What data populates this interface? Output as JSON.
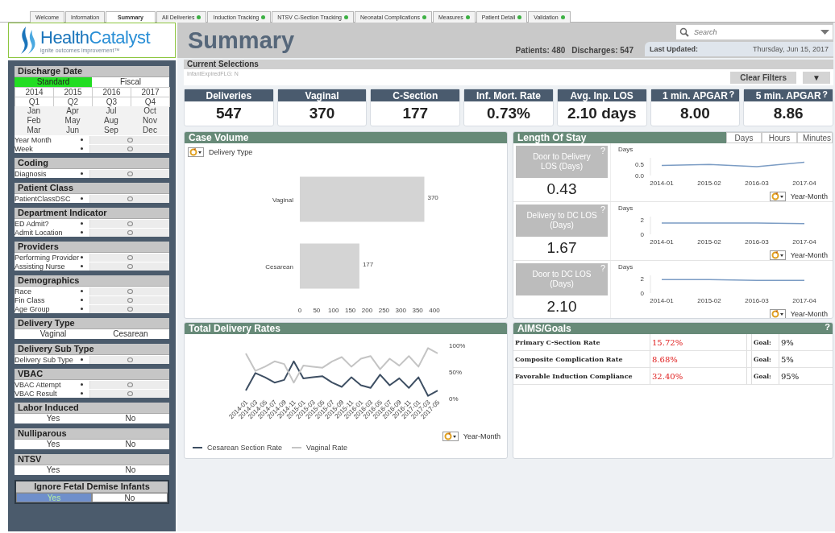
{
  "tabs": [
    {
      "label": "Welcome",
      "selected": false,
      "indicator": false
    },
    {
      "label": "Information",
      "selected": false,
      "indicator": false
    },
    {
      "label": "Summary",
      "selected": true,
      "indicator": false
    },
    {
      "label": "All Deliveries",
      "selected": false,
      "indicator": true
    },
    {
      "label": "Induction Tracking",
      "selected": false,
      "indicator": true
    },
    {
      "label": "NTSV C-Section Tracking",
      "selected": false,
      "indicator": true
    },
    {
      "label": "Neonatal Complications",
      "selected": false,
      "indicator": true
    },
    {
      "label": "Measures",
      "selected": false,
      "indicator": true
    },
    {
      "label": "Patient Detail",
      "selected": false,
      "indicator": true
    },
    {
      "label": "Validation",
      "selected": false,
      "indicator": true
    }
  ],
  "logo": {
    "wordmark_first": "Health",
    "wordmark_second": "Catalyst",
    "tagline": "ignite outcomes improvement™"
  },
  "header": {
    "title": "Summary",
    "patients": "Patients: 480",
    "discharges": "Discharges: 547",
    "search": {
      "placeholder": "Search"
    },
    "last_updated_label": "Last Updated:",
    "last_updated_value": "Thursday, Jun 15, 2017"
  },
  "sidebar": {
    "sections": [
      {
        "title": "Discharge Date",
        "kind": "panel",
        "blocks": [
          {
            "kind": "toggle",
            "options": [
              {
                "label": "Standard",
                "selected": true
              },
              {
                "label": "Fiscal",
                "selected": false
              }
            ]
          },
          {
            "kind": "grid",
            "framed": true,
            "rows": [
              [
                "2014",
                "2015",
                "2016",
                "2017"
              ]
            ]
          },
          {
            "kind": "grid",
            "framed": true,
            "rows": [
              [
                "Q1",
                "Q2",
                "Q3",
                "Q4"
              ]
            ]
          },
          {
            "kind": "grid",
            "framed": false,
            "rows": [
              [
                "Jan",
                "Apr",
                "Jul",
                "Oct"
              ],
              [
                "Feb",
                "May",
                "Aug",
                "Nov"
              ],
              [
                "Mar",
                "Jun",
                "Sep",
                "Dec"
              ]
            ]
          },
          {
            "kind": "dropdowns",
            "items": [
              "Year Month",
              "Week"
            ]
          }
        ]
      },
      {
        "title": "Coding",
        "kind": "panel",
        "blocks": [
          {
            "kind": "dropdowns",
            "items": [
              "Diagnosis"
            ]
          }
        ]
      },
      {
        "title": "Patient Class",
        "kind": "panel",
        "blocks": [
          {
            "kind": "dropdowns",
            "items": [
              "PatientClassDSC"
            ]
          }
        ]
      },
      {
        "title": "Department Indicator",
        "kind": "panel",
        "blocks": [
          {
            "kind": "dropdowns",
            "items": [
              "ED Admit?",
              "Admit Location"
            ]
          }
        ]
      },
      {
        "title": "Providers",
        "kind": "panel",
        "blocks": [
          {
            "kind": "dropdowns",
            "items": [
              "Performing Provider",
              "Assisting Nurse"
            ]
          }
        ]
      },
      {
        "title": "Demographics",
        "kind": "panel",
        "blocks": [
          {
            "kind": "dropdowns",
            "items": [
              "Race",
              "Fin Class",
              "Age Group"
            ]
          }
        ]
      },
      {
        "title": "Delivery Type",
        "kind": "panel",
        "blocks": [
          {
            "kind": "toggle",
            "options": [
              {
                "label": "Vaginal",
                "selected": false
              },
              {
                "label": "Cesarean",
                "selected": false
              }
            ]
          }
        ]
      },
      {
        "title": "Delivery Sub Type",
        "kind": "panel",
        "blocks": [
          {
            "kind": "dropdowns",
            "items": [
              "Delivery Sub Type"
            ]
          }
        ]
      },
      {
        "title": "VBAC",
        "kind": "panel",
        "blocks": [
          {
            "kind": "dropdowns",
            "items": [
              "VBAC Attempt",
              "VBAC Result"
            ]
          }
        ]
      },
      {
        "title": "Labor Induced",
        "kind": "panel",
        "blocks": [
          {
            "kind": "toggle",
            "options": [
              {
                "label": "Yes",
                "selected": false
              },
              {
                "label": "No",
                "selected": false
              }
            ]
          }
        ]
      },
      {
        "title": "Nulliparous",
        "kind": "panel",
        "blocks": [
          {
            "kind": "toggle",
            "options": [
              {
                "label": "Yes",
                "selected": false
              },
              {
                "label": "No",
                "selected": false
              }
            ]
          }
        ]
      },
      {
        "title": "NTSV",
        "kind": "panel",
        "blocks": [
          {
            "kind": "toggle",
            "options": [
              {
                "label": "Yes",
                "selected": false
              },
              {
                "label": "No",
                "selected": false
              }
            ]
          }
        ]
      },
      {
        "title": "Ignore Fetal Demise Infants",
        "kind": "boxed",
        "blocks": [
          {
            "kind": "toggle",
            "options": [
              {
                "label": "Yes",
                "selected": true
              },
              {
                "label": "No",
                "selected": false
              }
            ]
          }
        ]
      }
    ]
  },
  "current_selections": {
    "title": "Current Selections",
    "items": [
      "InfantExpiredFLG: N"
    ],
    "clear_button": "Clear Filters",
    "menu_button": "▼"
  },
  "kpis": [
    {
      "label": "Deliveries",
      "value": "547"
    },
    {
      "label": "Vaginal",
      "value": "370"
    },
    {
      "label": "C-Section",
      "value": "177"
    },
    {
      "label": "Inf. Mort. Rate",
      "value": "0.73%"
    },
    {
      "label": "Avg. Inp. LOS",
      "value": "2.10 days"
    },
    {
      "label": "1 min. APGAR",
      "help": "?",
      "value": "8.00"
    },
    {
      "label": "5 min. APGAR",
      "help": "?",
      "value": "8.86"
    }
  ],
  "case_volume": {
    "title": "Case Volume",
    "chart_data": {
      "type": "bar",
      "orientation": "horizontal",
      "ylabel": "Delivery Type",
      "categories": [
        "Vaginal",
        "Cesarean"
      ],
      "values": [
        370,
        177
      ],
      "xlim": [
        0,
        400
      ],
      "xticks": [
        0,
        50,
        100,
        150,
        200,
        250,
        300,
        350,
        400
      ],
      "data_labels": true
    }
  },
  "length_of_stay": {
    "title": "Length Of Stay",
    "units": [
      "Days",
      "Hours",
      "Minutes"
    ],
    "metrics": [
      {
        "label": "Door to Delivery LOS (Days)",
        "help": "?",
        "value": "0.43",
        "chart_data": {
          "type": "line",
          "ylabel": "Days",
          "xlabel": "Year-Month",
          "categories": [
            "2014-01",
            "2015-02",
            "2016-03",
            "2017-04"
          ],
          "ylim": [
            0,
            0.8
          ],
          "yticks": [
            {
              "value": 0,
              "label": "0.0"
            },
            {
              "value": 0.5,
              "label": "0.5"
            }
          ],
          "series": [
            {
              "color": "#7b9cc4",
              "values": [
                0.45,
                0.5,
                0.4,
                0.6
              ]
            }
          ]
        }
      },
      {
        "label": "Delivery to DC LOS (Days)",
        "help": "?",
        "value": "1.67",
        "chart_data": {
          "type": "line",
          "ylabel": "Days",
          "xlabel": "Year-Month",
          "categories": [
            "2014-01",
            "2015-02",
            "2016-03",
            "2017-04"
          ],
          "ylim": [
            0,
            2.5
          ],
          "yticks": [
            {
              "value": 0,
              "label": "0"
            },
            {
              "value": 2,
              "label": "2"
            }
          ],
          "series": [
            {
              "color": "#7b9cc4",
              "values": [
                1.6,
                1.6,
                1.6,
                1.5
              ]
            }
          ]
        }
      },
      {
        "label": "Door to DC LOS (Days)",
        "help": "?",
        "value": "2.10",
        "chart_data": {
          "type": "line",
          "ylabel": "Days",
          "xlabel": "Year-Month",
          "categories": [
            "2014-01",
            "2015-02",
            "2016-03",
            "2017-04"
          ],
          "ylim": [
            0,
            2.5
          ],
          "yticks": [
            {
              "value": 0,
              "label": "0"
            },
            {
              "value": 2,
              "label": "2"
            }
          ],
          "series": [
            {
              "color": "#7b9cc4",
              "values": [
                1.9,
                1.9,
                1.8,
                1.8
              ]
            }
          ]
        }
      }
    ]
  },
  "delivery_rates": {
    "title": "Total Delivery Rates",
    "chart_data": {
      "type": "line",
      "xlabel": "Year-Month",
      "ylim": [
        0,
        1
      ],
      "yticks": [
        {
          "value": 0,
          "label": "0%"
        },
        {
          "value": 0.5,
          "label": "50%"
        },
        {
          "value": 1,
          "label": "100%"
        }
      ],
      "categories": [
        "2014-01",
        "2014-03",
        "2014-05",
        "2014-07",
        "2014-09",
        "2014-11",
        "2015-01",
        "2015-03",
        "2015-05",
        "2015-07",
        "2015-09",
        "2015-11",
        "2016-01",
        "2016-03",
        "2016-05",
        "2016-07",
        "2016-09",
        "2016-11",
        "2017-01",
        "2017-03",
        "2017-05"
      ],
      "series": [
        {
          "name": "Cesarean Section Rate",
          "color": "#3e4f63",
          "values": [
            0.15,
            0.48,
            0.4,
            0.3,
            0.35,
            0.7,
            0.38,
            0.4,
            0.42,
            0.3,
            0.22,
            0.4,
            0.25,
            0.2,
            0.45,
            0.25,
            0.38,
            0.2,
            0.4,
            0.05,
            0.15
          ]
        },
        {
          "name": "Vaginal Rate",
          "color": "#c4c4c4",
          "values": [
            0.85,
            0.52,
            0.6,
            0.7,
            0.65,
            0.3,
            0.62,
            0.6,
            0.58,
            0.7,
            0.78,
            0.6,
            0.75,
            0.8,
            0.55,
            0.75,
            0.62,
            0.8,
            0.6,
            0.95,
            0.85
          ]
        }
      ]
    }
  },
  "aims_goals": {
    "title": "AIMS/Goals",
    "help": "?",
    "rows": [
      {
        "measure": "Primary C-Section Rate",
        "value": "15.72%",
        "goal_label": "Goal:",
        "goal": "9%"
      },
      {
        "measure": "Composite Complication Rate",
        "value": "8.68%",
        "goal_label": "Goal:",
        "goal": "5%"
      },
      {
        "measure": "Favorable Induction Compliance",
        "value": "32.40%",
        "goal_label": "Goal:",
        "goal": "95%"
      }
    ]
  }
}
